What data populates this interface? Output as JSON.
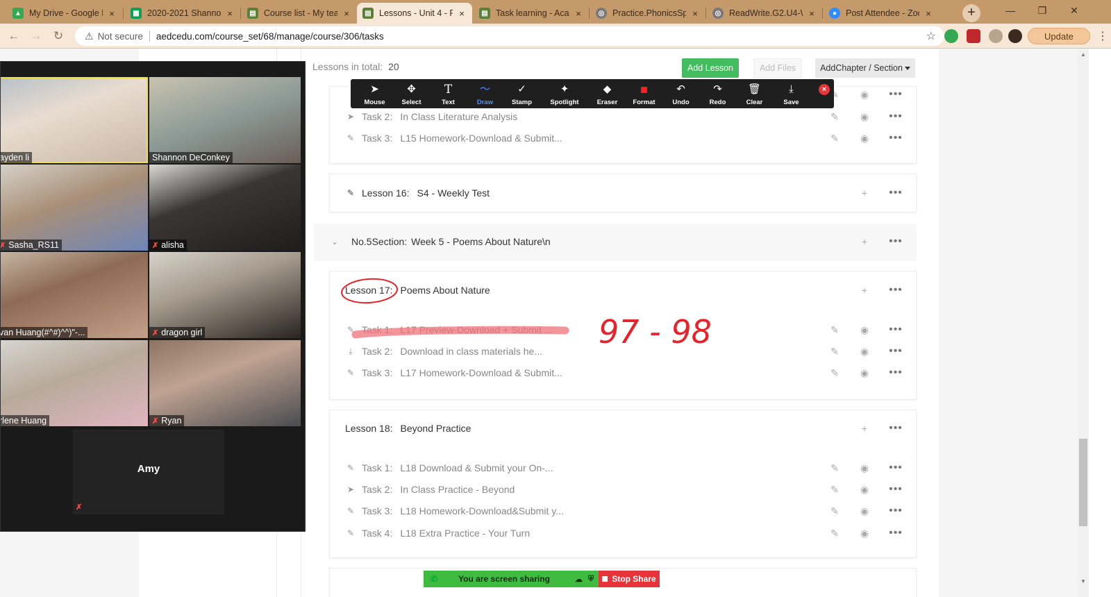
{
  "browser": {
    "tabs": [
      {
        "title": "My Drive - Google D",
        "favicon": "google-drive-icon",
        "color": "#34a853"
      },
      {
        "title": "2020-2021 Shannon",
        "favicon": "google-sheets-icon",
        "color": "#0f9d58"
      },
      {
        "title": "Course list - My teac",
        "favicon": "site-icon",
        "color": "#5b7f3a"
      },
      {
        "title": "Lessons - Unit 4 - P",
        "favicon": "site-icon",
        "color": "#5b7f3a",
        "active": true
      },
      {
        "title": "Task learning - Acad",
        "favicon": "site-icon",
        "color": "#5b7f3a"
      },
      {
        "title": "Practice.PhonicsSpe",
        "favicon": "globe-icon",
        "color": "#666666"
      },
      {
        "title": "ReadWrite.G2.U4-W",
        "favicon": "globe-icon",
        "color": "#666666"
      },
      {
        "title": "Post Attendee - Zoo",
        "favicon": "zoom-icon",
        "color": "#2d8cff"
      }
    ],
    "close_glyph": "×",
    "new_tab_glyph": "+",
    "window_minimize": "—",
    "window_restore": "❐",
    "window_close": "✕",
    "not_secure": "Not secure",
    "url": "aedcedu.com/course_set/68/manage/course/306/tasks",
    "update_label": "Update",
    "accent": "#c59a6a"
  },
  "course": {
    "lessons_total_label": "Lessons in total:",
    "lessons_total_value": "20",
    "add_lesson": "Add Lesson",
    "add_files": "Add Files",
    "add_chapter": "AddChapter / Section",
    "group_a_tasks": [
      {
        "label": "Task 2:",
        "title": "In Class Literature Analysis",
        "icon": "send-icon"
      },
      {
        "label": "Task 3:",
        "title": "L15 Homework-Download & Submit...",
        "icon": "pencil-icon"
      }
    ],
    "lesson16": {
      "label": "Lesson 16:",
      "title": "S4 - Weekly Test"
    },
    "section5": {
      "label": "No.5Section:",
      "title": "Week 5 - Poems About Nature\\n"
    },
    "lesson17": {
      "label": "Lesson 17:",
      "title": "Poems About Nature",
      "tasks": [
        {
          "label": "Task 1:",
          "title": "L17 Preview-Download + Submit ...",
          "icon": "pencil-icon"
        },
        {
          "label": "Task 2:",
          "title": "Download in class materials he...",
          "icon": "download-icon"
        },
        {
          "label": "Task 3:",
          "title": "L17 Homework-Download & Submit...",
          "icon": "pencil-icon"
        }
      ]
    },
    "lesson18": {
      "label": "Lesson 18:",
      "title": "Beyond Practice",
      "tasks": [
        {
          "label": "Task 1:",
          "title": "L18 Download & Submit your On-...",
          "icon": "pencil-icon"
        },
        {
          "label": "Task 2:",
          "title": "In Class Practice - Beyond",
          "icon": "send-icon"
        },
        {
          "label": "Task 3:",
          "title": "L18 Homework-Download&Submit y...",
          "icon": "pencil-icon"
        },
        {
          "label": "Task 4:",
          "title": "L18 Extra Practice - Your Turn",
          "icon": "pencil-icon"
        }
      ]
    },
    "accent_green": "#43bc60"
  },
  "annotate": {
    "tools": [
      {
        "label": "Mouse",
        "icon": "cursor-icon",
        "glyph": "➤"
      },
      {
        "label": "Select",
        "icon": "move-icon",
        "glyph": "✥"
      },
      {
        "label": "Text",
        "icon": "text-icon",
        "glyph": "T"
      },
      {
        "label": "Draw",
        "icon": "draw-icon",
        "glyph": "〜",
        "active": true
      },
      {
        "label": "Stamp",
        "icon": "check-icon",
        "glyph": "✓"
      },
      {
        "label": "Spotlight",
        "icon": "spotlight-icon",
        "glyph": "✦"
      },
      {
        "label": "Eraser",
        "icon": "eraser-icon",
        "glyph": "◆"
      },
      {
        "label": "Format",
        "icon": "format-icon",
        "glyph": "■"
      },
      {
        "label": "Undo",
        "icon": "undo-icon",
        "glyph": "↶"
      },
      {
        "label": "Redo",
        "icon": "redo-icon",
        "glyph": "↷"
      },
      {
        "label": "Clear",
        "icon": "trash-icon",
        "glyph": "🗑"
      },
      {
        "label": "Save",
        "icon": "save-icon",
        "glyph": "⤓"
      }
    ],
    "close_glyph": "×",
    "active_color": "#4c93ff",
    "format_color": "#ff2020"
  },
  "gallery": {
    "participants": [
      {
        "name": "ayden li",
        "muted": false,
        "speaking": true
      },
      {
        "name": "Shannon DeConkey",
        "muted": false
      },
      {
        "name": "Sasha_RS11",
        "muted": true
      },
      {
        "name": "alisha",
        "muted": true
      },
      {
        "name": "van Huang(#^#)^^)\"-...",
        "muted": false
      },
      {
        "name": "dragon girl",
        "muted": true
      },
      {
        "name": "rlene Huang",
        "muted": false
      },
      {
        "name": "Ryan",
        "muted": true
      }
    ],
    "amy": "Amy",
    "mic_glyph": "✗",
    "mute_color": "#ff4d4d"
  },
  "share": {
    "sharing_text": "You are screen sharing",
    "stop_text": "Stop Share",
    "green": "#3fbb3f",
    "red": "#e6343a"
  },
  "handwriting": {
    "text": "97 - 98",
    "color": "#e8222a"
  }
}
